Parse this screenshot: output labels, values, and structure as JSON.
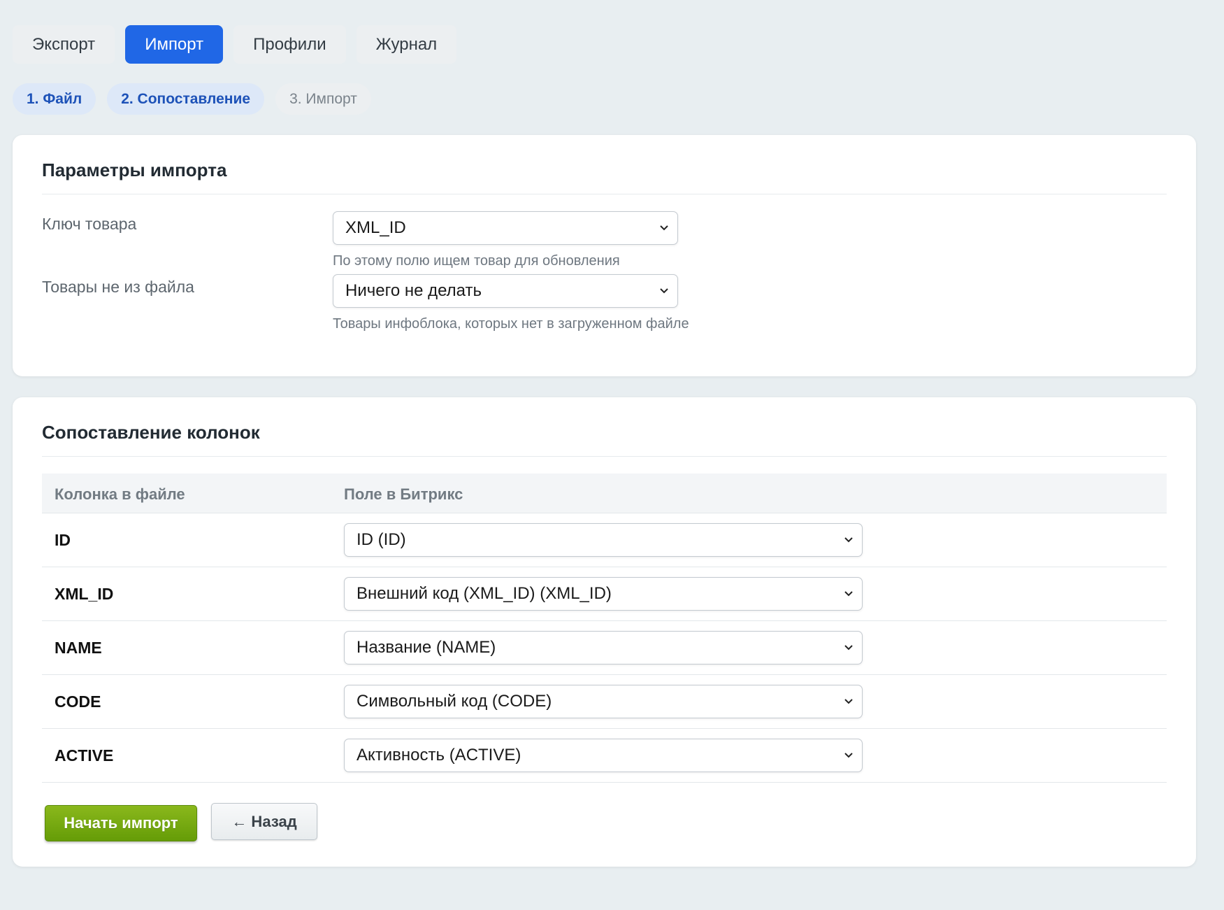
{
  "tabs": [
    {
      "label": "Экспорт",
      "active": false
    },
    {
      "label": "Импорт",
      "active": true
    },
    {
      "label": "Профили",
      "active": false
    },
    {
      "label": "Журнал",
      "active": false
    }
  ],
  "steps": [
    {
      "label": "1. Файл",
      "state": "done"
    },
    {
      "label": "2. Сопоставление",
      "state": "done"
    },
    {
      "label": "3. Импорт",
      "state": "pending"
    }
  ],
  "params_panel": {
    "title": "Параметры импорта",
    "product_key": {
      "label": "Ключ товара",
      "value": "XML_ID",
      "hint": "По этому полю ищем товар для обновления"
    },
    "missing_products": {
      "label": "Товары не из файла",
      "value": "Ничего не делать",
      "hint": "Товары инфоблока, которых нет в загруженном файле"
    }
  },
  "mapping_panel": {
    "title": "Сопоставление колонок",
    "columns": [
      "Колонка в файле",
      "Поле в Битрикс"
    ],
    "rows": [
      {
        "file_column": "ID",
        "bitrix_field": "ID (ID)"
      },
      {
        "file_column": "XML_ID",
        "bitrix_field": "Внешний код (XML_ID) (XML_ID)"
      },
      {
        "file_column": "NAME",
        "bitrix_field": "Название (NAME)"
      },
      {
        "file_column": "CODE",
        "bitrix_field": "Символьный код (CODE)"
      },
      {
        "file_column": "ACTIVE",
        "bitrix_field": "Активность (ACTIVE)"
      }
    ]
  },
  "actions": {
    "start_label": "Начать импорт",
    "back_label": "← Назад"
  },
  "colors": {
    "accent": "#2067e6",
    "step_done_text": "#1d52b8",
    "primary_button": "#76aa12",
    "background": "#e8eef1"
  },
  "icons": {
    "select_arrow": "chevron-down-icon"
  }
}
